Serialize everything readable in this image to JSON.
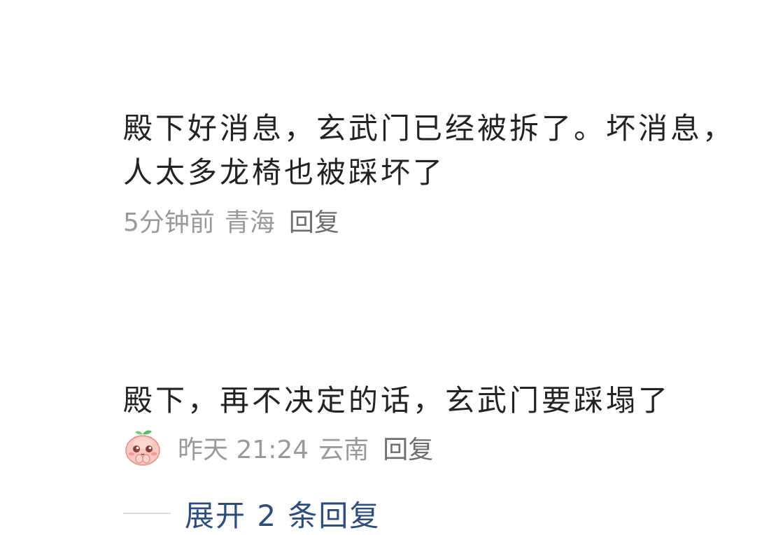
{
  "comments": [
    {
      "text": "殿下好消息，玄武门已经被拆了。坏消息，人太多龙椅也被踩坏了",
      "time": "5分钟前",
      "region": "青海",
      "reply_label": "回复"
    },
    {
      "text": "殿下，再不决定的话，玄武门要踩塌了",
      "sticker_icon": "blushing-peach-sticker-icon",
      "time": "昨天 21:24",
      "region": "云南",
      "reply_label": "回复"
    }
  ],
  "expand_replies_label": "展开 2 条回复",
  "colors": {
    "text": "#232323",
    "meta": "#9a9a9a",
    "link": "#2d4d7a"
  }
}
